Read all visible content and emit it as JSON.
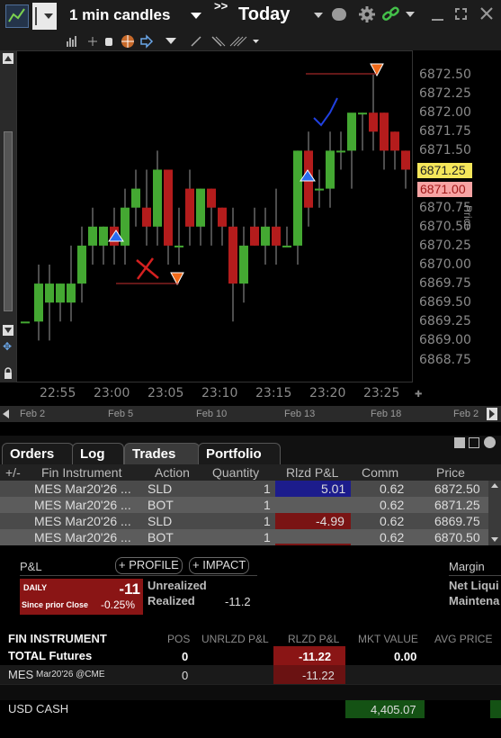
{
  "toolbar": {
    "bar_size": "1 min candles",
    "period": "Today",
    "expand": ">>"
  },
  "chart": {
    "price_axis_title": "Price",
    "price_ticks": [
      "6872.50",
      "6872.25",
      "6872.00",
      "6871.75",
      "6871.50",
      "6871.25",
      "6871.00",
      "6870.75",
      "6870.50",
      "6870.25",
      "6870.00",
      "6869.75",
      "6869.50",
      "6869.25",
      "6869.00",
      "6868.75"
    ],
    "last_price_tag": "6871.25",
    "bid_price_tag": "6871.00",
    "time_ticks": [
      "22:55",
      "23:00",
      "23:05",
      "23:10",
      "23:15",
      "23:20",
      "23:25"
    ],
    "date_ticks": [
      "Feb 2",
      "Feb 5",
      "Feb 10",
      "Feb 13",
      "Feb 18",
      "Feb 2"
    ],
    "colors": {
      "up": "#44a832",
      "down": "#b41c1c",
      "last_tag": "#f5e65a",
      "bid_tag": "#f7a3a3"
    }
  },
  "tabs": [
    "Orders",
    "Log",
    "Trades",
    "Portfolio"
  ],
  "active_tab": "Trades",
  "trades": {
    "headers": [
      "+/-",
      "Fin Instrument",
      "Action",
      "Quantity",
      "Rlzd P&L",
      "Comm",
      "Price"
    ],
    "rows": [
      {
        "instrument": "MES Mar20'26 ...",
        "action": "SLD",
        "qty": "1",
        "pnl": "5.01",
        "comm": "0.62",
        "price": "6872.50"
      },
      {
        "instrument": "MES Mar20'26 ...",
        "action": "BOT",
        "qty": "1",
        "pnl": "",
        "comm": "0.62",
        "price": "6871.25"
      },
      {
        "instrument": "MES Mar20'26 ...",
        "action": "SLD",
        "qty": "1",
        "pnl": "-4.99",
        "comm": "0.62",
        "price": "6869.75"
      },
      {
        "instrument": "MES Mar20'26 ...",
        "action": "BOT",
        "qty": "1",
        "pnl": "",
        "comm": "0.62",
        "price": "6870.50"
      }
    ]
  },
  "pnl": {
    "title": "P&L",
    "profile_btn": "+ PROFILE",
    "impact_btn": "+ IMPACT",
    "daily_label": "DAILY",
    "daily_value": "-11",
    "since_label": "Since prior Close",
    "since_value": "-0.25%",
    "unrealized_label": "Unrealized",
    "realized_label": "Realized",
    "realized_value": "-11.2",
    "margin_title": "Margin",
    "net_liq": "Net Liqui",
    "maint": "Maintena"
  },
  "portfolio": {
    "headers": [
      "FIN INSTRUMENT",
      "POS",
      "UNRLZD P&L",
      "RLZD P&L",
      "MKT VALUE",
      "AVG PRICE"
    ],
    "total_label": "TOTAL Futures",
    "total_pos": "0",
    "total_rlzd": "-11.22",
    "total_mkt": "0.00",
    "mes_label": "MES",
    "mes_contract": "Mar20'26 @CME",
    "mes_pos": "0",
    "mes_rlzd": "-11.22",
    "cash_label": "USD CASH",
    "cash_value": "4,405.07"
  },
  "annotations": {
    "x_mark": "✗",
    "check_mark": "✓"
  }
}
